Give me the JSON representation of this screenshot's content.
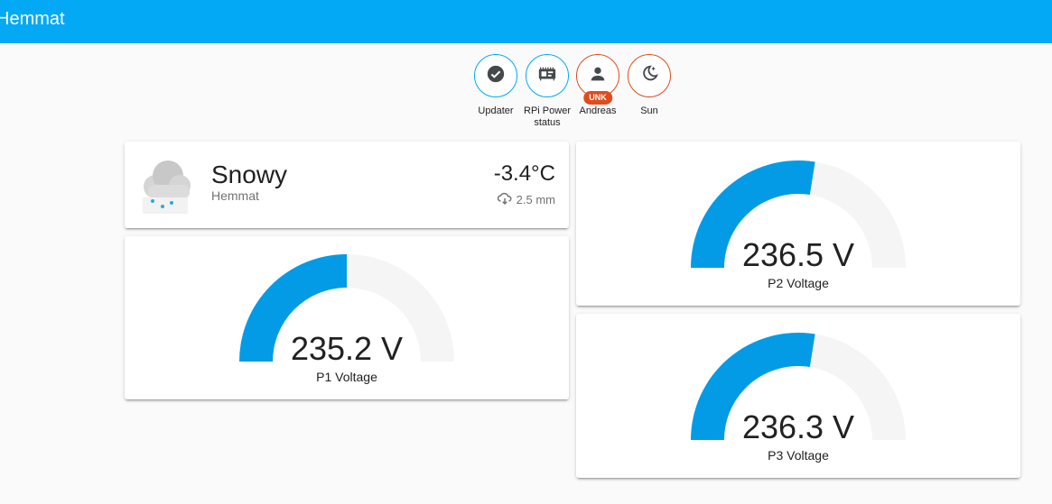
{
  "header": {
    "title": "Hemmat"
  },
  "colors": {
    "accent": "#03a9f4",
    "warn": "#df4c1e",
    "gauge_fill": "#039be5",
    "gauge_track": "#f5f5f5"
  },
  "badges": [
    {
      "label": "Updater",
      "icon": "check-circle-icon"
    },
    {
      "label": "RPi Power status",
      "icon": "raspberry-pi-icon"
    },
    {
      "label": "Andreas",
      "icon": "person-icon",
      "tag": "UNK"
    },
    {
      "label": "Sun",
      "icon": "moon-star-icon"
    }
  ],
  "weather": {
    "condition": "Snowy",
    "location": "Hemmat",
    "temperature": "-3.4°C",
    "precipitation": "2.5 mm",
    "icon": "snow-cloud-icon"
  },
  "gauges": {
    "p1": {
      "value_text": "235.2 V",
      "name": "P1 Voltage",
      "fraction": 0.5
    },
    "p2": {
      "value_text": "236.5 V",
      "name": "P2 Voltage",
      "fraction": 0.55
    },
    "p3": {
      "value_text": "236.3 V",
      "name": "P3 Voltage",
      "fraction": 0.55
    }
  }
}
